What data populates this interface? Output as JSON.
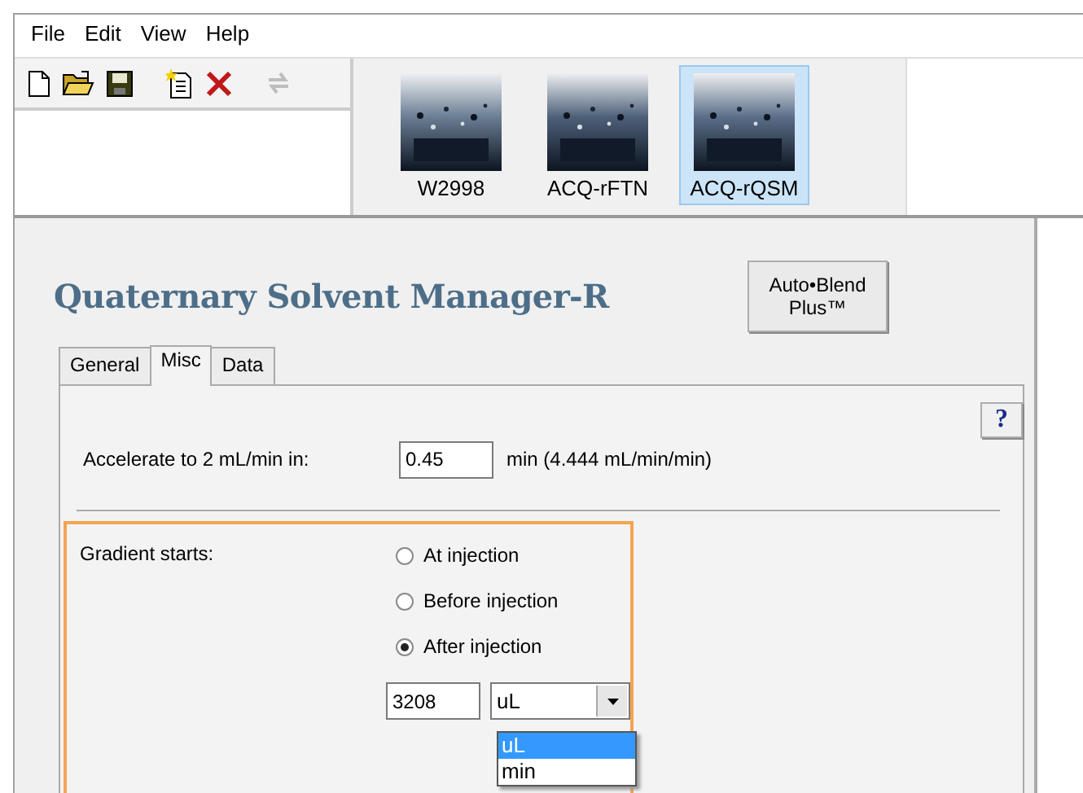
{
  "menu": [
    "File",
    "Edit",
    "View",
    "Help"
  ],
  "toolbar": [
    {
      "kind": "new",
      "disabled": false
    },
    {
      "kind": "open",
      "disabled": false
    },
    {
      "kind": "save",
      "disabled": false
    },
    {
      "kind": "paste",
      "disabled": false
    },
    {
      "kind": "delete",
      "disabled": false
    },
    {
      "kind": "refresh",
      "disabled": true
    }
  ],
  "instruments": [
    {
      "label": "W2998",
      "selected": false
    },
    {
      "label": "ACQ-rFTN",
      "selected": false
    },
    {
      "label": "ACQ-rQSM",
      "selected": true
    }
  ],
  "panel": {
    "title": "Quaternary Solvent Manager-R",
    "blend_button": "Auto•Blend Plus™",
    "tabs": [
      {
        "label": "General",
        "selected": false
      },
      {
        "label": "Misc",
        "selected": true
      },
      {
        "label": "Data",
        "selected": false
      }
    ],
    "help_button": "?",
    "accelerate": {
      "label": "Accelerate to 2 mL/min in:",
      "value": "0.45",
      "unit": "min (4.444 mL/min/min)"
    },
    "gradient": {
      "label": "Gradient starts:",
      "options": [
        {
          "label": "At injection",
          "selected": false
        },
        {
          "label": "Before injection",
          "selected": false
        },
        {
          "label": "After injection",
          "selected": true
        }
      ],
      "amount": "3208",
      "unit": {
        "value": "uL",
        "open": true,
        "options": [
          {
            "label": "uL",
            "selected": true
          },
          {
            "label": "min",
            "selected": false
          }
        ]
      }
    }
  }
}
